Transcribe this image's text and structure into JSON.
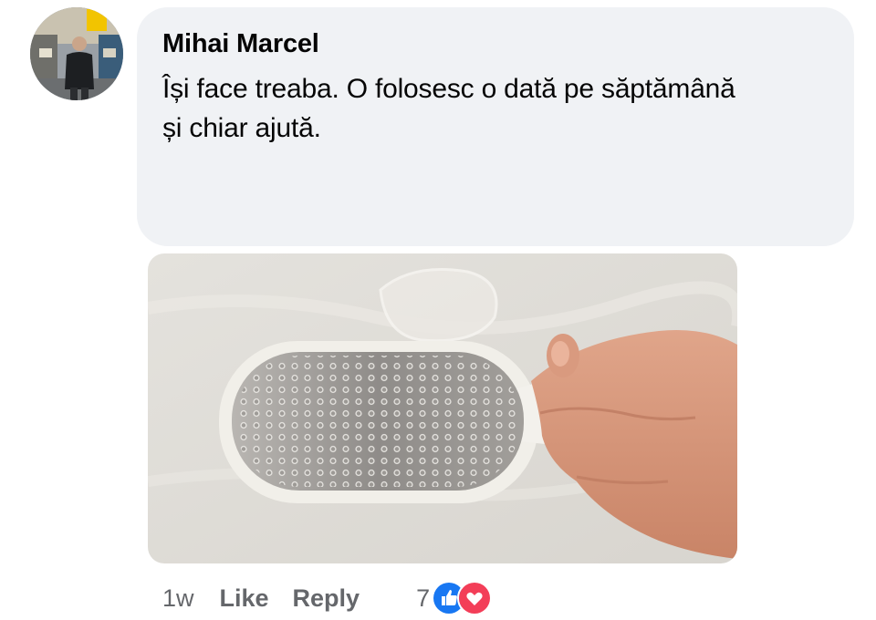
{
  "comment": {
    "author": "Mihai Marcel",
    "text": "Își face treaba. O folosesc o dată pe săptămână și chiar ajută."
  },
  "actions": {
    "time": "1w",
    "like_label": "Like",
    "reply_label": "Reply",
    "reaction_count": "7",
    "reactions": [
      "like-icon",
      "love-icon"
    ]
  },
  "colors": {
    "bubble_bg": "#f0f2f5",
    "meta_text": "#65676b",
    "like_blue": "#1877f2",
    "love_red": "#f33e58"
  }
}
